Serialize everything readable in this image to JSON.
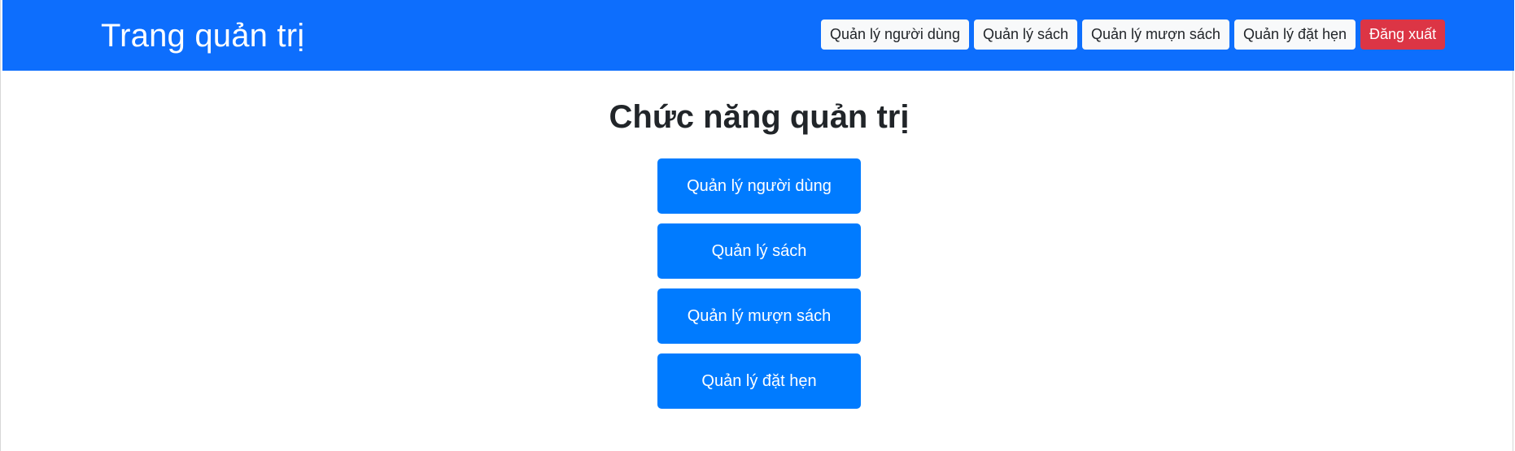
{
  "header": {
    "brand": "Trang quản trị",
    "nav": [
      {
        "label": "Quản lý người dùng"
      },
      {
        "label": "Quản lý sách"
      },
      {
        "label": "Quản lý mượn sách"
      },
      {
        "label": "Quản lý đặt hẹn"
      },
      {
        "label": "Đăng xuất"
      }
    ]
  },
  "main": {
    "title": "Chức năng quản trị",
    "actions": [
      {
        "label": "Quản lý người dùng"
      },
      {
        "label": "Quản lý sách"
      },
      {
        "label": "Quản lý mượn sách"
      },
      {
        "label": "Quản lý đặt hẹn"
      }
    ]
  },
  "colors": {
    "header_bg": "#0d6efd",
    "nav_button_bg": "#f8f9fa",
    "logout_bg": "#dc3545",
    "action_button_bg": "#007bff"
  }
}
